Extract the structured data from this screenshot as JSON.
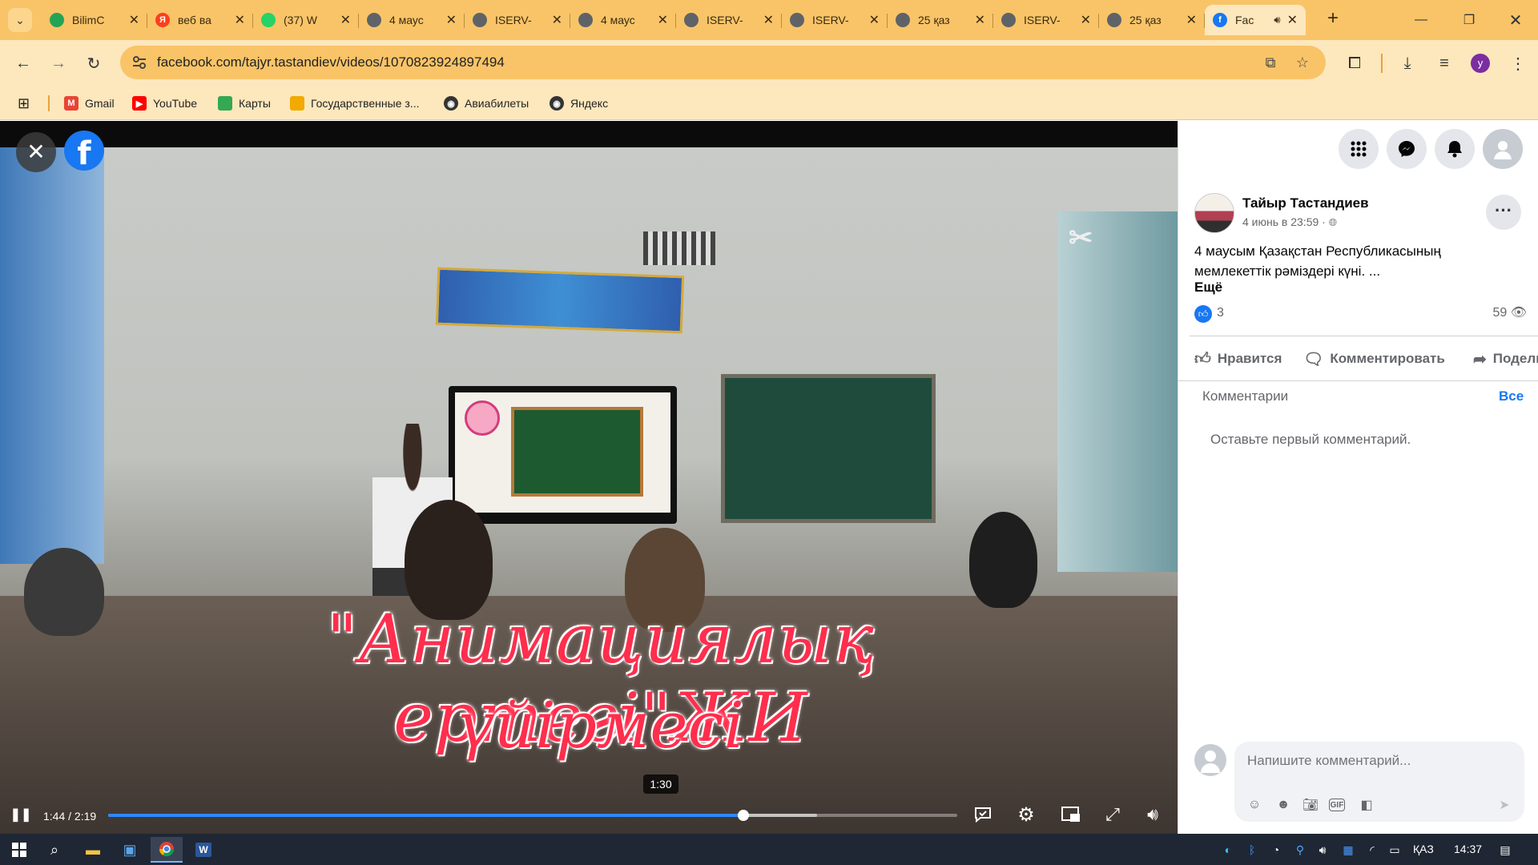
{
  "browser": {
    "tabs": [
      {
        "title": "BilimC",
        "favicon": "green-circle-icon",
        "color": "#23a455"
      },
      {
        "title": "веб ва",
        "favicon": "yandex-icon",
        "color": "#fc3f1d"
      },
      {
        "title": "(37) W",
        "favicon": "whatsapp-icon",
        "color": "#25d366"
      },
      {
        "title": "4 маус",
        "favicon": "globe-icon",
        "color": "#5f6368"
      },
      {
        "title": "ISERV-",
        "favicon": "globe-icon",
        "color": "#5f6368"
      },
      {
        "title": "4 маус",
        "favicon": "globe-icon",
        "color": "#5f6368"
      },
      {
        "title": "ISERV-",
        "favicon": "globe-icon",
        "color": "#5f6368"
      },
      {
        "title": "ISERV-",
        "favicon": "globe-icon",
        "color": "#5f6368"
      },
      {
        "title": "25 қаз",
        "favicon": "globe-icon",
        "color": "#5f6368"
      },
      {
        "title": "ISERV-",
        "favicon": "globe-icon",
        "color": "#5f6368"
      },
      {
        "title": "25 қаз",
        "favicon": "globe-icon",
        "color": "#5f6368"
      },
      {
        "title": "Fac",
        "favicon": "facebook-icon",
        "color": "#1877f2",
        "active": true
      }
    ],
    "url": "facebook.com/tajyr.tastandiev/videos/1070823924897494",
    "profile_letter": "y",
    "bookmarks": [
      {
        "label": "Gmail",
        "icon": "gmail-icon",
        "color": "#ea4335"
      },
      {
        "label": "YouTube",
        "icon": "youtube-icon",
        "color": "#ff0000"
      },
      {
        "label": "Карты",
        "icon": "maps-icon",
        "color": "#34a853"
      },
      {
        "label": "Государственные з...",
        "icon": "gov-icon",
        "color": "#f2a900"
      },
      {
        "label": "Авиабилеты",
        "icon": "globe-icon",
        "color": "#333333"
      },
      {
        "label": "Яндекс",
        "icon": "globe-icon",
        "color": "#333333"
      }
    ]
  },
  "video": {
    "caption_line1": "\"Анимациялық ертегі\"ЖИ",
    "caption_line2": "үйірмесі",
    "watermark": "✂",
    "tooltip_time": "1:30",
    "current_time": "1:44",
    "duration": "2:19",
    "progress_fraction": 0.748,
    "buffered_fraction": 0.835
  },
  "post": {
    "author": "Тайыр Тастандиев",
    "date": "4 июнь в 23:59 ·",
    "text": "4 маусым Қазақстан Республикасының мемлекеттік рәміздері күні. ...",
    "more": "Ещё",
    "likes": "3",
    "views": "59",
    "actions": {
      "like": "Нравится",
      "comment": "Комментировать",
      "share": "Поделиться"
    },
    "comments_header": "Комментарии",
    "comments_filter": "Все",
    "empty_comments": "Оставьте первый комментарий.",
    "composer_placeholder": "Напишите комментарий..."
  },
  "taskbar": {
    "language": "ҚАЗ",
    "time": "14:37"
  }
}
